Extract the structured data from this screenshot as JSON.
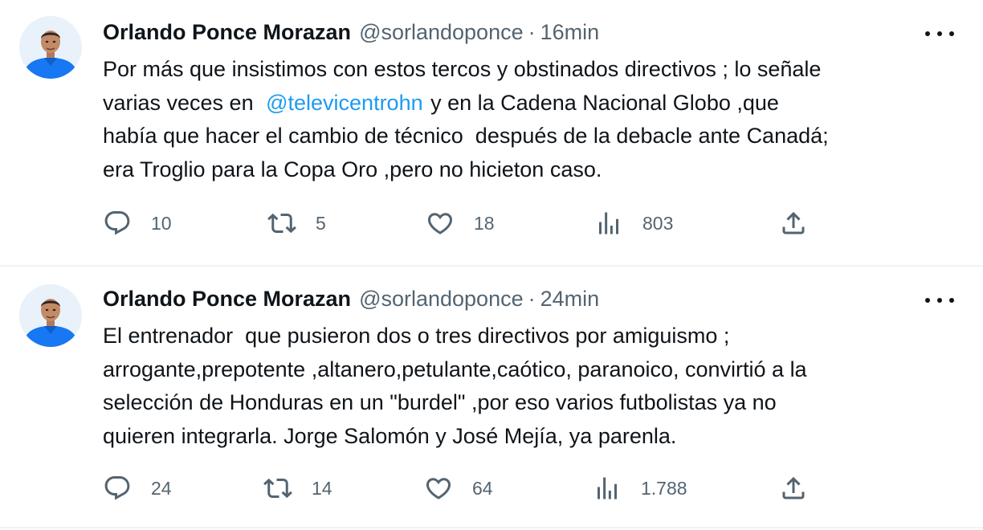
{
  "tweets": [
    {
      "author_name": "Orlando Ponce Morazan",
      "handle": "@sorlandoponce",
      "separator": "·",
      "time": "16min",
      "text_line1": "Por más que insistimos con estos tercos y obstinados directivos ; lo señale",
      "text_line2_before": "varias veces en ",
      "mention": "@televicentrohn",
      "text_line2_after": " y en la Cadena Nacional Globo ,que",
      "text_line3": "había que hacer el cambio de técnico  después de la debacle ante Canadá;",
      "text_line4": "era Troglio para la Copa Oro ,pero no hicieton caso.",
      "replies": "10",
      "reposts": "5",
      "likes": "18",
      "views": "803"
    },
    {
      "author_name": "Orlando Ponce Morazan",
      "handle": "@sorlandoponce",
      "separator": "·",
      "time": "24min",
      "text_line1": "El entrenador  que pusieron dos o tres directivos por amiguismo ;",
      "text_line2": "arrogante,prepotente ,altanero,petulante,caótico, paranoico, convirtió a la",
      "text_line3": "selección de Honduras en un \"burdel\" ,por eso varios futbolistas ya no",
      "text_line4": "quieren integrarla. Jorge Salomón y José Mejía, ya parenla.",
      "replies": "24",
      "reposts": "14",
      "likes": "64",
      "views": "1.788"
    }
  ],
  "colors": {
    "text": "#0f1419",
    "secondary": "#536471",
    "link": "#1d9bf0",
    "divider": "#eff3f4",
    "avatar_shirt": "#1877f2"
  },
  "icons": [
    "reply-icon",
    "repost-icon",
    "like-icon",
    "views-icon",
    "share-icon",
    "more-icon"
  ]
}
